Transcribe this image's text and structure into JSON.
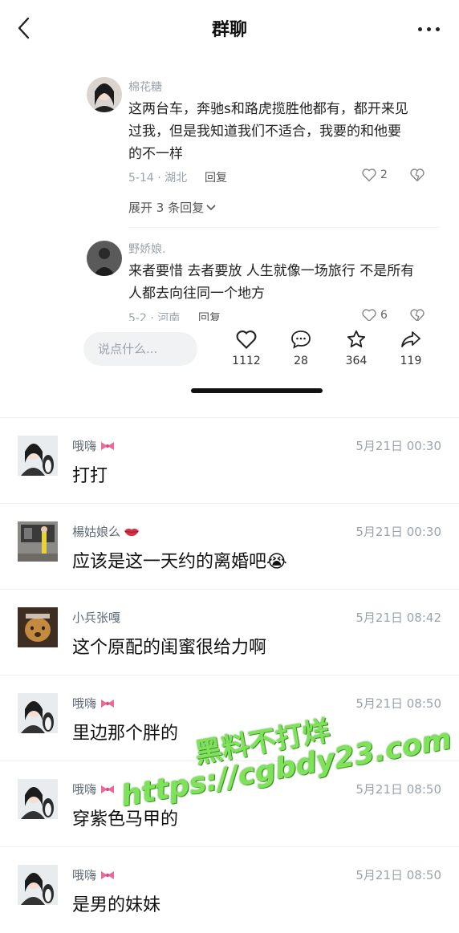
{
  "header": {
    "title": "群聊"
  },
  "comments": [
    {
      "name": "棉花糖",
      "text_lines": [
        "这两台车，奔驰s和路虎揽胜他都有，都开来见",
        "过我，但是我知道我们不适合，我要的和他要",
        "的不一样"
      ],
      "date_loc": "5-14 · 湖北",
      "reply": "回复",
      "likes": "2",
      "expand": "展开 3 条回复"
    },
    {
      "name": "野娇娘.",
      "text_lines": [
        "来者要惜 去者要放 人生就像一场旅行 不是所有",
        "人都去向往同一个地方"
      ],
      "date_loc": "5-2 · 河南",
      "reply": "回复",
      "likes": "6"
    }
  ],
  "comment_bar": {
    "placeholder": "说点什么...",
    "likes": "1112",
    "comments": "28",
    "favorites": "364",
    "shares": "119"
  },
  "messages": [
    {
      "name": "哦嗨",
      "name_icon": "bow-icon",
      "time": "5月21日 00:30",
      "text": "打打"
    },
    {
      "name": "楊姑娘么",
      "name_icon": "lips-icon",
      "time": "5月21日 00:30",
      "text": "应该是这一天约的离婚吧",
      "emoji": "😭"
    },
    {
      "name": "小兵张嘎",
      "name_icon": "",
      "time": "5月21日 08:42",
      "text": "这个原配的闺蜜很给力啊"
    },
    {
      "name": "哦嗨",
      "name_icon": "bow-icon",
      "time": "5月21日 08:50",
      "text": "里边那个胖的"
    },
    {
      "name": "哦嗨",
      "name_icon": "bow-icon",
      "time": "5月21日 08:50",
      "text": "穿紫色马甲的"
    },
    {
      "name": "哦嗨",
      "name_icon": "bow-icon",
      "time": "5月21日 08:50",
      "text": "是男的妹妹"
    }
  ],
  "watermark": {
    "line1": "黑料不打烊",
    "line2": "https://cgbdy23.com"
  },
  "colors": {
    "accent_bow": "#e86b9a",
    "lips": "#d9334a",
    "watermark": "#7fe35a"
  }
}
